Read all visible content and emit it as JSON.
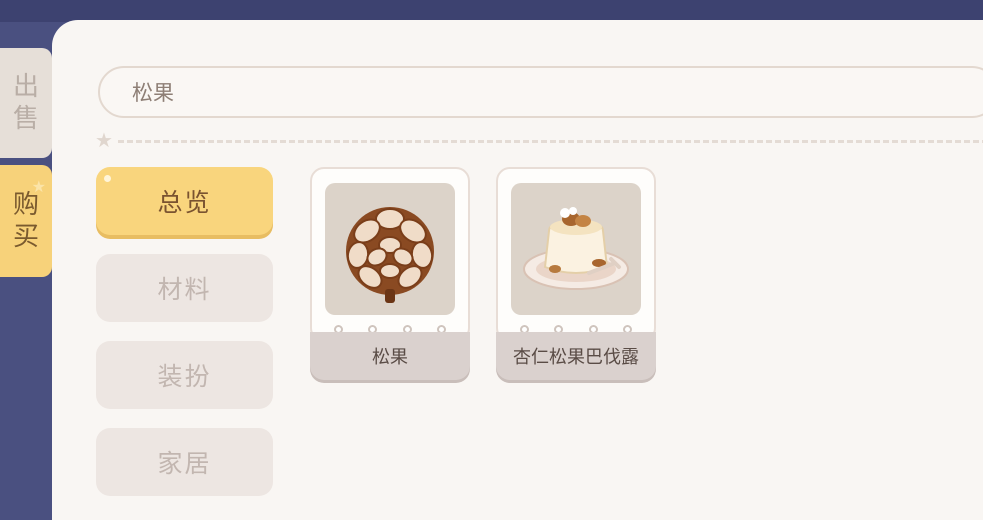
{
  "side_tabs": [
    {
      "label": "出\n售",
      "active": false
    },
    {
      "label": "购\n买",
      "active": true
    }
  ],
  "search": {
    "value": "松果"
  },
  "categories": [
    {
      "label": "总览",
      "active": true
    },
    {
      "label": "材料",
      "active": false
    },
    {
      "label": "装扮",
      "active": false
    },
    {
      "label": "家居",
      "active": false
    }
  ],
  "items": [
    {
      "name": "松果",
      "icon": "pinecone-icon"
    },
    {
      "name": "杏仁松果巴伐露",
      "icon": "almond-pudding-icon"
    }
  ],
  "colors": {
    "accent": "#f9d57d",
    "panel": "#f9f6f3",
    "background": "#4a5080"
  }
}
